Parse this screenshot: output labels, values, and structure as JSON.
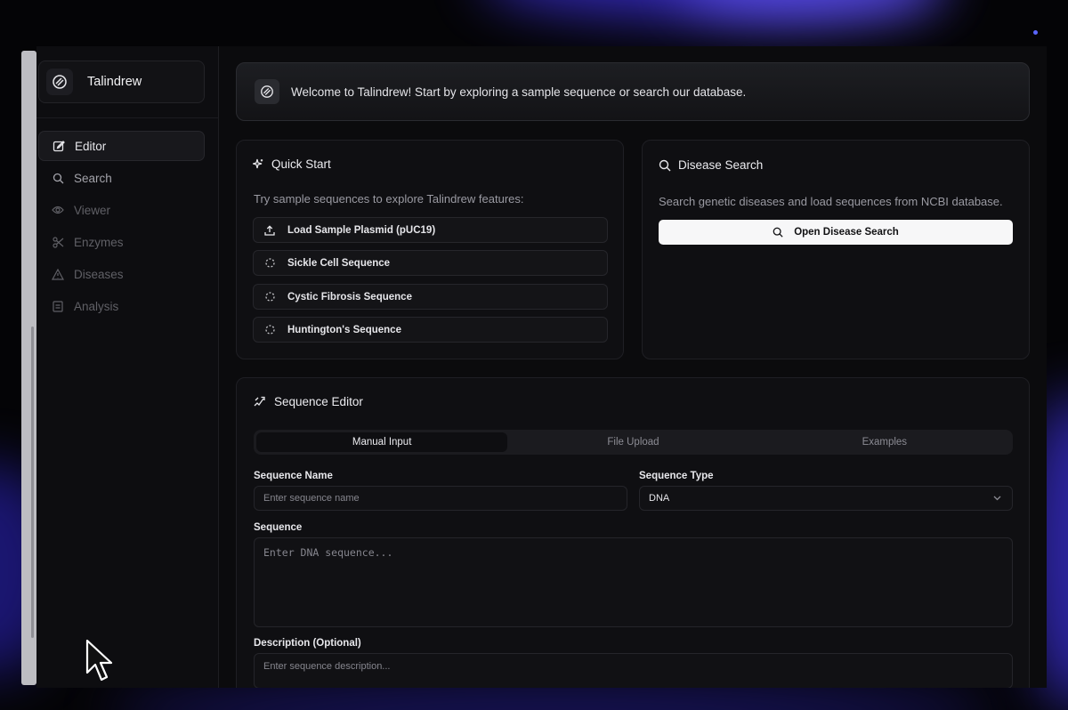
{
  "app": {
    "name": "Talindrew"
  },
  "sidebar": {
    "items": [
      {
        "label": "Editor",
        "icon": "edit-icon"
      },
      {
        "label": "Search",
        "icon": "search-icon"
      },
      {
        "label": "Viewer",
        "icon": "eye-icon"
      },
      {
        "label": "Enzymes",
        "icon": "scissors-icon"
      },
      {
        "label": "Diseases",
        "icon": "warning-icon"
      },
      {
        "label": "Analysis",
        "icon": "clipboard-icon"
      }
    ]
  },
  "welcome": {
    "text": "Welcome to Talindrew! Start by exploring a sample sequence or search our database."
  },
  "quick_start": {
    "title": "Quick Start",
    "description": "Try sample sequences to explore Talindrew features:",
    "buttons": [
      {
        "label": "Load Sample Plasmid (pUC19)",
        "icon": "upload-icon"
      },
      {
        "label": "Sickle Cell Sequence",
        "icon": "loader-icon"
      },
      {
        "label": "Cystic Fibrosis Sequence",
        "icon": "loader-icon"
      },
      {
        "label": "Huntington's Sequence",
        "icon": "loader-icon"
      }
    ]
  },
  "disease_search": {
    "title": "Disease Search",
    "description": "Search genetic diseases and load sequences from NCBI database.",
    "button_label": "Open Disease Search"
  },
  "sequence_editor": {
    "title": "Sequence Editor",
    "tabs": [
      "Manual Input",
      "File Upload",
      "Examples"
    ],
    "active_tab": "Manual Input",
    "name_label": "Sequence Name",
    "name_placeholder": "Enter sequence name",
    "type_label": "Sequence Type",
    "type_value": "DNA",
    "sequence_label": "Sequence",
    "sequence_placeholder": "Enter DNA sequence...",
    "description_label": "Description (Optional)",
    "description_placeholder": "Enter sequence description..."
  },
  "colors": {
    "background": "#0b0b0d",
    "accent_glow": "#3b2fd6",
    "primary_button": "#f7f7f8"
  }
}
